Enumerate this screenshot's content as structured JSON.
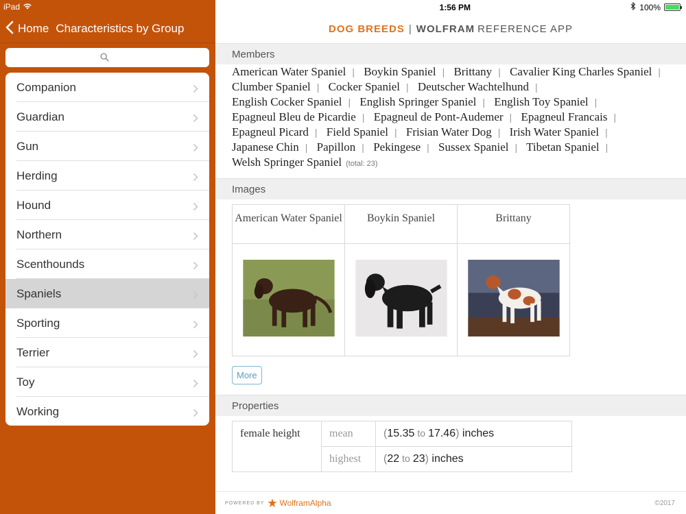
{
  "status": {
    "device": "iPad",
    "time": "1:56 PM",
    "battery": "100%"
  },
  "left": {
    "back_label": "Home",
    "title": "Characteristics by Group",
    "search_placeholder": "",
    "groups": [
      {
        "label": "Companion"
      },
      {
        "label": "Guardian"
      },
      {
        "label": "Gun"
      },
      {
        "label": "Herding"
      },
      {
        "label": "Hound"
      },
      {
        "label": "Northern"
      },
      {
        "label": "Scenthounds"
      },
      {
        "label": "Spaniels"
      },
      {
        "label": "Sporting"
      },
      {
        "label": "Terrier"
      },
      {
        "label": "Toy"
      },
      {
        "label": "Working"
      }
    ],
    "selected": "Spaniels"
  },
  "header": {
    "app_name": "DOG BREEDS",
    "separator": "|",
    "brand": "WOLFRAM",
    "ref": "REFERENCE APP"
  },
  "sections": {
    "members": {
      "title": "Members",
      "items": [
        "American Water Spaniel",
        "Boykin Spaniel",
        "Brittany",
        "Cavalier King Charles Spaniel",
        "Clumber Spaniel",
        "Cocker Spaniel",
        "Deutscher Wachtelhund",
        "English Cocker Spaniel",
        "English Springer Spaniel",
        "English Toy Spaniel",
        "Epagneul Bleu de Picardie",
        "Epagneul de Pont-Audemer",
        "Epagneul Francais",
        "Epagneul Picard",
        "Field Spaniel",
        "Frisian Water Dog",
        "Irish Water Spaniel",
        "Japanese Chin",
        "Papillon",
        "Pekingese",
        "Sussex Spaniel",
        "Tibetan Spaniel",
        "Welsh Springer Spaniel"
      ],
      "total": "(total: 23)"
    },
    "images": {
      "title": "Images",
      "names": [
        "American Water Spaniel",
        "Boykin Spaniel",
        "Brittany"
      ],
      "more_label": "More"
    },
    "properties": {
      "title": "Properties",
      "rows": [
        {
          "name": "female height",
          "stat": "mean",
          "low": "15.35",
          "high": "17.46",
          "unit": "inches",
          "to": "to"
        },
        {
          "name": "",
          "stat": "highest",
          "low": "22",
          "high": "23",
          "unit": "inches",
          "to": "to"
        }
      ]
    }
  },
  "footer": {
    "powered": "POWERED BY",
    "brand": "WolframAlpha",
    "copyright": "©2017"
  },
  "colors": {
    "sidebar_bg": "#c4530a",
    "accent_orange": "#e0731f",
    "battery_green": "#4cd964",
    "link_blue": "#5a9ec0"
  }
}
